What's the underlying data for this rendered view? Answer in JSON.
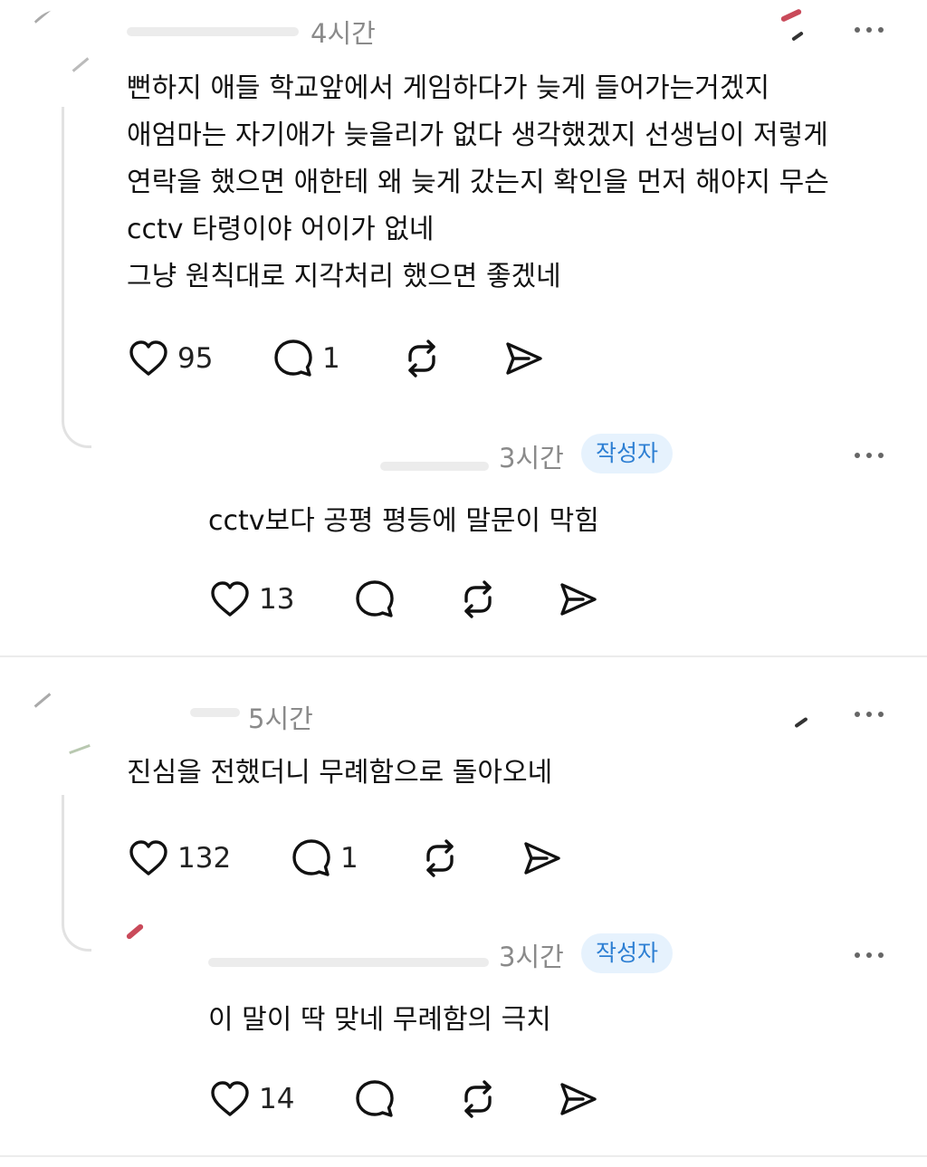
{
  "comments": [
    {
      "time": "4시간",
      "body": [
        "뻔하지 애들 학교앞에서 게임하다가 늦게 들어가는거겠지",
        "애엄마는 자기애가 늦을리가 없다 생각했겠지 선생님이 저렇게",
        "연락을 했으면 애한테 왜 늦게 갔는지 확인을 먼저 해야지 무슨",
        "cctv 타령이야 어이가 없네",
        "그냥 원칙대로 지각처리 했으면 좋겠네"
      ],
      "likes": "95",
      "replies": "1",
      "reply": {
        "time": "3시간",
        "badge": "작성자",
        "body": "cctv보다 공평 평등에 말문이 막힘",
        "likes": "13"
      }
    },
    {
      "time": "5시간",
      "body": [
        "진심을 전했더니 무례함으로 돌아오네"
      ],
      "likes": "132",
      "replies": "1",
      "reply": {
        "time": "3시간",
        "badge": "작성자",
        "body": "이 말이 딱 맞네 무례함의 극치",
        "likes": "14"
      }
    }
  ],
  "icons": {
    "like": "heart-icon",
    "comment": "comment-bubble-icon",
    "repost": "repost-icon",
    "share": "send-icon",
    "more": "more-options-icon"
  },
  "colors": {
    "badge_bg": "#e6f2fd",
    "badge_text": "#2d7fd3",
    "meta": "#8a8a8a"
  }
}
